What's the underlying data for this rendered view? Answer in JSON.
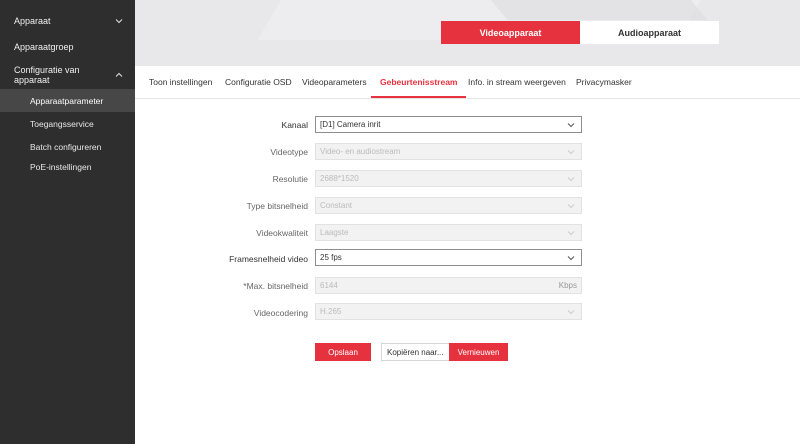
{
  "sidebar": {
    "groups": [
      {
        "label": "Apparaat",
        "icon": "chevron-down-icon"
      },
      {
        "label": "Apparaatgroep"
      },
      {
        "label": "Configuratie van apparaat",
        "icon": "chevron-up-icon"
      }
    ],
    "items": [
      {
        "label": "Apparaatparameter",
        "active": true
      },
      {
        "label": "Toegangsservice"
      },
      {
        "label": "Batch configureren"
      },
      {
        "label": "PoE-instellingen"
      }
    ]
  },
  "device_tabs": {
    "video": "Videoapparaat",
    "audio": "Audioapparaat",
    "active": "video"
  },
  "tabs": [
    {
      "label": "Toon instellingen"
    },
    {
      "label": "Configuratie OSD"
    },
    {
      "label": "Videoparameters"
    },
    {
      "label": "Gebeurtenisstream",
      "active": true
    },
    {
      "label": "Info. in stream weergeven"
    },
    {
      "label": "Privacymasker"
    }
  ],
  "form": {
    "channel": {
      "label": "Kanaal",
      "value": "[D1] Camera inrit"
    },
    "video_type": {
      "label": "Videotype",
      "value": "Video- en audiostream"
    },
    "resolution": {
      "label": "Resolutie",
      "value": "2688*1520"
    },
    "bitrate_type": {
      "label": "Type bitsnelheid",
      "value": "Constant"
    },
    "video_quality": {
      "label": "Videokwaliteit",
      "value": "Laagste"
    },
    "frame_rate": {
      "label": "Framesnelheid video",
      "value": "25 fps"
    },
    "max_bitrate": {
      "label": "*Max. bitsnelheid",
      "value": "6144",
      "unit": "Kbps"
    },
    "video_encoding": {
      "label": "Videocodering",
      "value": "H.265"
    }
  },
  "buttons": {
    "save": "Opslaan",
    "copy_to": "Kopiëren naar...",
    "refresh": "Vernieuwen"
  },
  "colors": {
    "accent": "#e6323e",
    "sidebar_bg": "#2e2e2e",
    "sidebar_active": "#474747"
  }
}
